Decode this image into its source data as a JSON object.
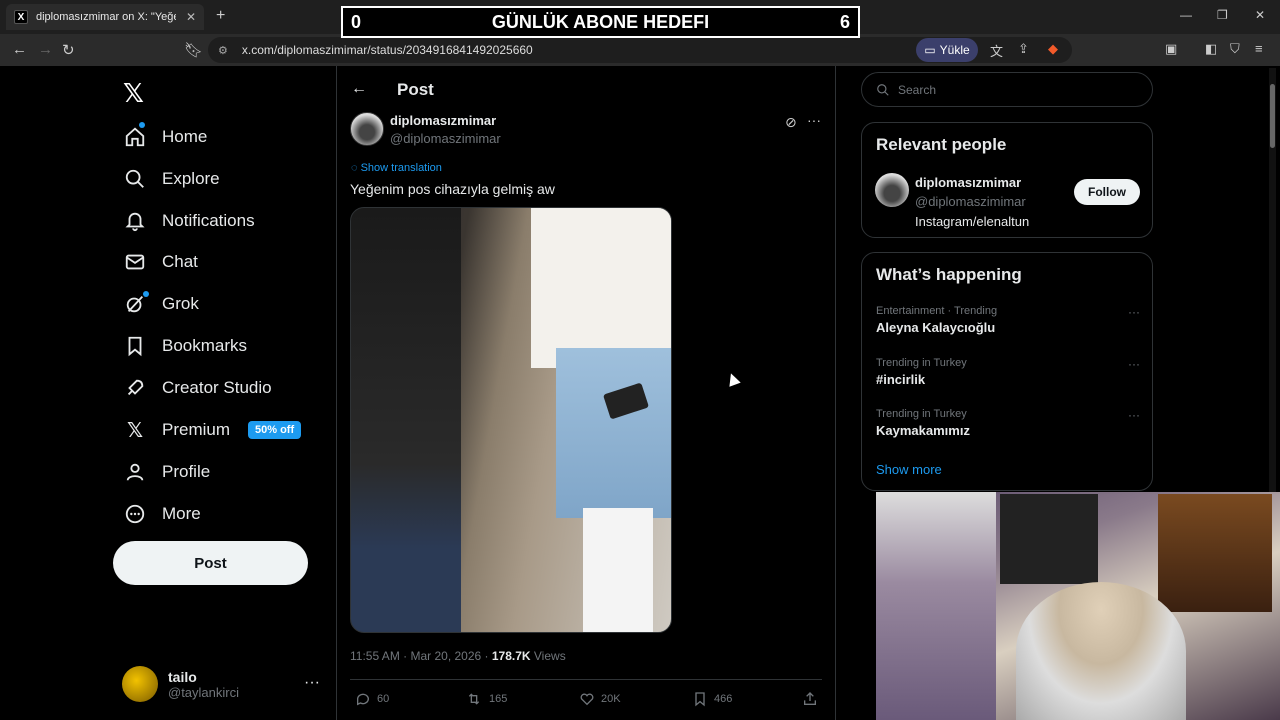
{
  "browser": {
    "tab_title": "diplomasızmimar on X: \"Yeğenim",
    "url": "x.com/diplomaszimimar/status/2034916841492025660",
    "yukle_label": "Yükle"
  },
  "overlay": {
    "left_num": "0",
    "title": "GÜNLÜK ABONE HEDEFI",
    "right_num": "6"
  },
  "sidebar": {
    "items": [
      {
        "label": "Home"
      },
      {
        "label": "Explore"
      },
      {
        "label": "Notifications"
      },
      {
        "label": "Chat"
      },
      {
        "label": "Grok"
      },
      {
        "label": "Bookmarks"
      },
      {
        "label": "Creator Studio"
      },
      {
        "label": "Premium"
      },
      {
        "label": "Profile"
      },
      {
        "label": "More"
      }
    ],
    "premium_badge": "50% off",
    "post_label": "Post",
    "user": {
      "name": "tailo",
      "handle": "@taylankirci"
    }
  },
  "post": {
    "header_title": "Post",
    "author_name": "diplomasızmimar",
    "author_handle": "@diplomaszimimar",
    "show_translation": "Show translation",
    "text": "Yeğenim pos cihazıyla gelmiş aw",
    "time": "11:55 AM · Mar 20, 2026 · ",
    "views_count": "178.7K",
    "views_label": " Views",
    "replies": "60",
    "reposts": "165",
    "likes": "20K",
    "bookmarks": "466"
  },
  "right": {
    "search_placeholder": "Search",
    "relevant_title": "Relevant people",
    "rp_name": "diplomasızmimar",
    "rp_handle": "@diplomaszimimar",
    "rp_bio": "Instagram/elenaltun",
    "follow_label": "Follow",
    "happening_title": "What’s happening",
    "trends": [
      {
        "category": "Entertainment · Trending",
        "name": "Aleyna Kalaycıoğlu"
      },
      {
        "category": "Trending in Turkey",
        "name": "#incirlik"
      },
      {
        "category": "Trending in Turkey",
        "name": "Kaymakamımız"
      }
    ],
    "show_more": "Show more"
  },
  "colors": {
    "accent": "#1d9bf0",
    "background": "#000000",
    "border": "#2f3336"
  }
}
